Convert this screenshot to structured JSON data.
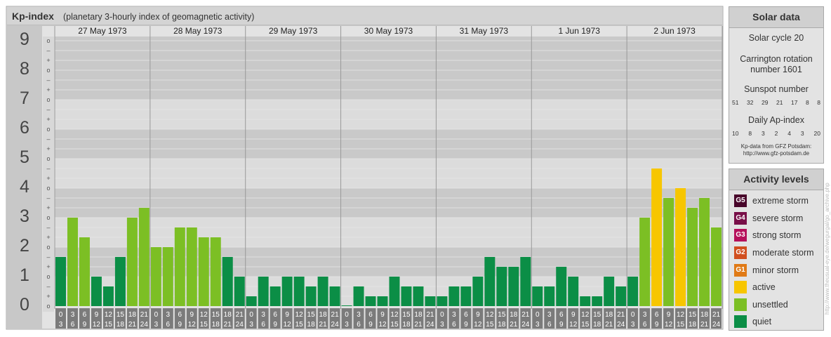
{
  "header": {
    "title": "Kp-index",
    "subtitle": "(planetary 3-hourly index of geomagnetic activity)"
  },
  "chart_data": {
    "type": "bar",
    "y_axis_labels": [
      "0",
      "1",
      "2",
      "3",
      "4",
      "5",
      "6",
      "7",
      "8",
      "9"
    ],
    "minor_marks": [
      "o",
      "+",
      "–"
    ],
    "ylim": [
      0,
      9.33
    ],
    "days": [
      "27 May 1973",
      "28 May 1973",
      "29 May 1973",
      "30 May 1973",
      "31 May 1973",
      "1 Jun 1973",
      "2 Jun 1973"
    ],
    "interval_start": [
      "0",
      "3",
      "6",
      "9",
      "12",
      "15",
      "18",
      "21"
    ],
    "interval_end": [
      "3",
      "6",
      "9",
      "12",
      "15",
      "18",
      "21",
      "24"
    ],
    "values": [
      1.667,
      3.0,
      2.333,
      1.0,
      0.667,
      1.667,
      3.0,
      3.333,
      2.0,
      2.0,
      2.667,
      2.667,
      2.333,
      2.333,
      1.667,
      1.0,
      0.333,
      1.0,
      0.667,
      1.0,
      1.0,
      0.667,
      1.0,
      0.667,
      0.0,
      0.667,
      0.333,
      0.333,
      1.0,
      0.667,
      0.667,
      0.333,
      0.333,
      0.667,
      0.667,
      1.0,
      1.667,
      1.333,
      1.333,
      1.667,
      0.667,
      0.667,
      1.333,
      1.0,
      0.333,
      0.333,
      1.0,
      0.667,
      1.0,
      3.0,
      4.667,
      3.667,
      4.0,
      3.333,
      3.667,
      2.667
    ],
    "colors": {
      "quiet": "#0b8e46",
      "unsettled": "#7cbf24",
      "active": "#f7c600",
      "minor": "#e07a16",
      "moderate": "#d14e1e",
      "strong": "#b5105a",
      "severe": "#780f48",
      "extreme": "#48062a"
    }
  },
  "solar": {
    "title": "Solar data",
    "cycle": "Solar cycle 20",
    "carrington_1": "Carrington rotation",
    "carrington_2": "number 1601",
    "sunspot_title": "Sunspot number",
    "sunspot_values": [
      "51",
      "32",
      "29",
      "21",
      "17",
      "8",
      "8"
    ],
    "ap_title": "Daily Ap-index",
    "ap_values": [
      "10",
      "8",
      "3",
      "2",
      "4",
      "3",
      "20"
    ],
    "credit_1": "Kp-data from GFZ Potsdam:",
    "credit_2": "http://www.gfz-potsdam.de"
  },
  "activity": {
    "title": "Activity levels",
    "levels": [
      {
        "code": "G5",
        "label": "extreme storm",
        "color": "#48062a"
      },
      {
        "code": "G4",
        "label": "severe storm",
        "color": "#780f48"
      },
      {
        "code": "G3",
        "label": "strong storm",
        "color": "#b5105a"
      },
      {
        "code": "G2",
        "label": "moderate storm",
        "color": "#d14e1e"
      },
      {
        "code": "G1",
        "label": "minor storm",
        "color": "#e07a16"
      },
      {
        "code": "",
        "label": "active",
        "color": "#f7c600"
      },
      {
        "code": "",
        "label": "unsettled",
        "color": "#7cbf24"
      },
      {
        "code": "",
        "label": "quiet",
        "color": "#0b8e46"
      }
    ]
  },
  "watermark": "http://www.theusual-eye.de/wegurgal/go_archive.php"
}
